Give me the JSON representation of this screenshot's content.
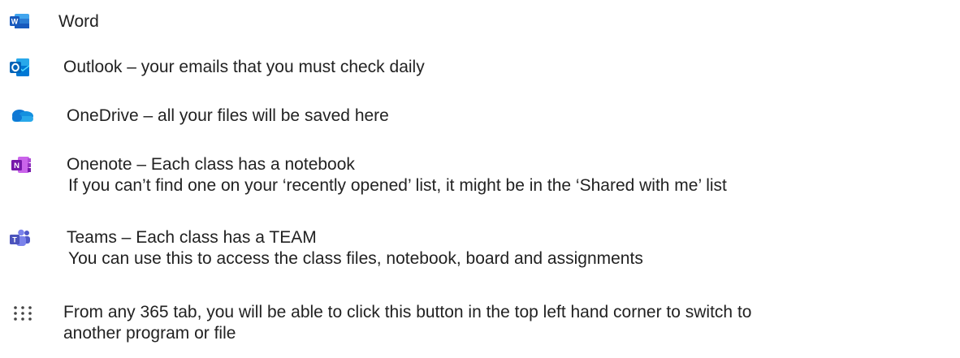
{
  "items": [
    {
      "icon": "word-icon",
      "line1": "Word"
    },
    {
      "icon": "outlook-icon",
      "line1": "Outlook – your emails that you must check daily"
    },
    {
      "icon": "onedrive-icon",
      "line1": "OneDrive – all your files will be saved here"
    },
    {
      "icon": "onenote-icon",
      "line1": "Onenote – Each class has a notebook",
      "line2": "If you can’t find one on your ‘recently opened’ list, it might be in the ‘Shared with me’ list"
    },
    {
      "icon": "teams-icon",
      "line1": "Teams – Each class has a TEAM",
      "line2": "You can use this to access the class files, notebook, board and assignments"
    },
    {
      "icon": "app-launcher-icon",
      "line1": "From any 365 tab, you will be able to click this button in the top left hand corner to switch to",
      "line2": "another program or file"
    }
  ],
  "colors": {
    "word_blue": "#2B579A",
    "word_light": "#41A5EE",
    "outlook_blue": "#0364B8",
    "outlook_light": "#28A8EA",
    "onedrive_blue": "#0F78D4",
    "onedrive_light": "#28A8EA",
    "onenote_purple": "#7719AA",
    "onenote_light": "#CA64EA",
    "teams_purple": "#5059C9",
    "teams_light": "#7B83EB",
    "launcher_gray": "#444444"
  }
}
